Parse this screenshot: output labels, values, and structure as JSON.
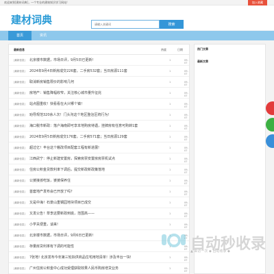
{
  "topbar": {
    "text": "欢迎来到[建材词典]，一个专业的建筑知识学习网站!",
    "favorite": "加入收藏"
  },
  "header": {
    "logo": "建材词典",
    "search_placeholder": "请输入关键词",
    "search_button": "搜索"
  },
  "nav": {
    "items": [
      "首页",
      "资讯"
    ]
  },
  "main": {
    "col_latest": "最新信息",
    "col_click": "热度",
    "col_date": "日期",
    "rows": [
      {
        "cat": "[最新信息]",
        "title": "北京楼市数据，市场日评，9月5日已更新!",
        "click": "1",
        "date": "09-07"
      },
      {
        "cat": "[最新信息]",
        "title": "2024年9月4日新房成交226套，二手房532套；当日房源111套",
        "click": "1",
        "date": "09-07"
      },
      {
        "cat": "[最新信息]",
        "title": "取消新房销售限价的影响几何",
        "click": "1",
        "date": "09-07"
      },
      {
        "cat": "[最新信息]",
        "title": "房地产：销售降幅收窄，关注核心城市量升征兆",
        "click": "1",
        "date": "09-07"
      },
      {
        "cat": "[最新信息]",
        "title": "站点图重收！快看看在大兴哪个镇！",
        "click": "1",
        "date": "09-07"
      },
      {
        "cat": "[最新信息]",
        "title": "劝导规范320余人次！门头沟这个地区整治区统行为!",
        "click": "1",
        "date": "09-07"
      },
      {
        "cat": "[最新信息]",
        "title": "海口税市新政：落户海南即可享本地购房待遇，挂牌房有任意可购转1套",
        "click": "1",
        "date": "09-07"
      },
      {
        "cat": "[最新信息]",
        "title": "2024年9月5日新房成交176套，二手房571套；当日房源129套",
        "click": "1",
        "date": "09-07"
      },
      {
        "cat": "[最新信息]",
        "title": "超过亿！丰台这个棚改项目配套工程有新进展!",
        "click": "1",
        "date": "09-07"
      },
      {
        "cat": "[最新信息]",
        "title": "江西武宁：停止新建安置房，探索房票安置房房票机试点",
        "click": "1",
        "date": "09-07"
      },
      {
        "cat": "[最新信息]",
        "title": "住房公积金贷款利率下调后，提交新政新政策落地",
        "click": "1",
        "date": "09-07"
      },
      {
        "cat": "[最新信息]",
        "title": "公婆接孩吃饭，婆婆保养住",
        "click": "1",
        "date": "09-07"
      },
      {
        "cat": "[最新信息]",
        "title": "首套地产发布会已开放了吗？",
        "click": "1",
        "date": "09-07"
      },
      {
        "cat": "[最新信息]",
        "title": "又是中海！石景山重钢园地块项目已成交",
        "click": "1",
        "date": "09-07"
      },
      {
        "cat": "[最新信息]",
        "title": "又发公告！草李这要新政到底，范围高——",
        "click": "1",
        "date": "09-07"
      },
      {
        "cat": "[最新信息]",
        "title": "小学关便重，谈来!",
        "click": "1",
        "date": "09-07"
      },
      {
        "cat": "[最新信息]",
        "title": "北京楼市数据，市场日评，9月6日已更新!",
        "click": "1",
        "date": "09-07"
      },
      {
        "cat": "[最新信息]",
        "title": "存量房贷利率有下调的可能性",
        "click": "1",
        "date": "09-07"
      },
      {
        "cat": "[最新信息]",
        "title": "7张地! 北京发布今年第三轮拟供商品住宅用地清单！涉及丰台一块!",
        "click": "1",
        "date": "09-07"
      },
      {
        "cat": "[最新信息]",
        "title": "广州住房公积金中心成功受理获取效果人民币购房增贷业务",
        "click": "1",
        "date": "09-07"
      }
    ]
  },
  "side": {
    "hot_title": "热门文章",
    "latest_title": "最新文章"
  },
  "watermark": {
    "text": "自动秒收录",
    "sub": "▲ 来访一次 ◆ 自动收录 ◆"
  },
  "colors": {
    "accent": "#3496d8",
    "nav": "#8ec8ec",
    "favorite": "#e8513b"
  }
}
